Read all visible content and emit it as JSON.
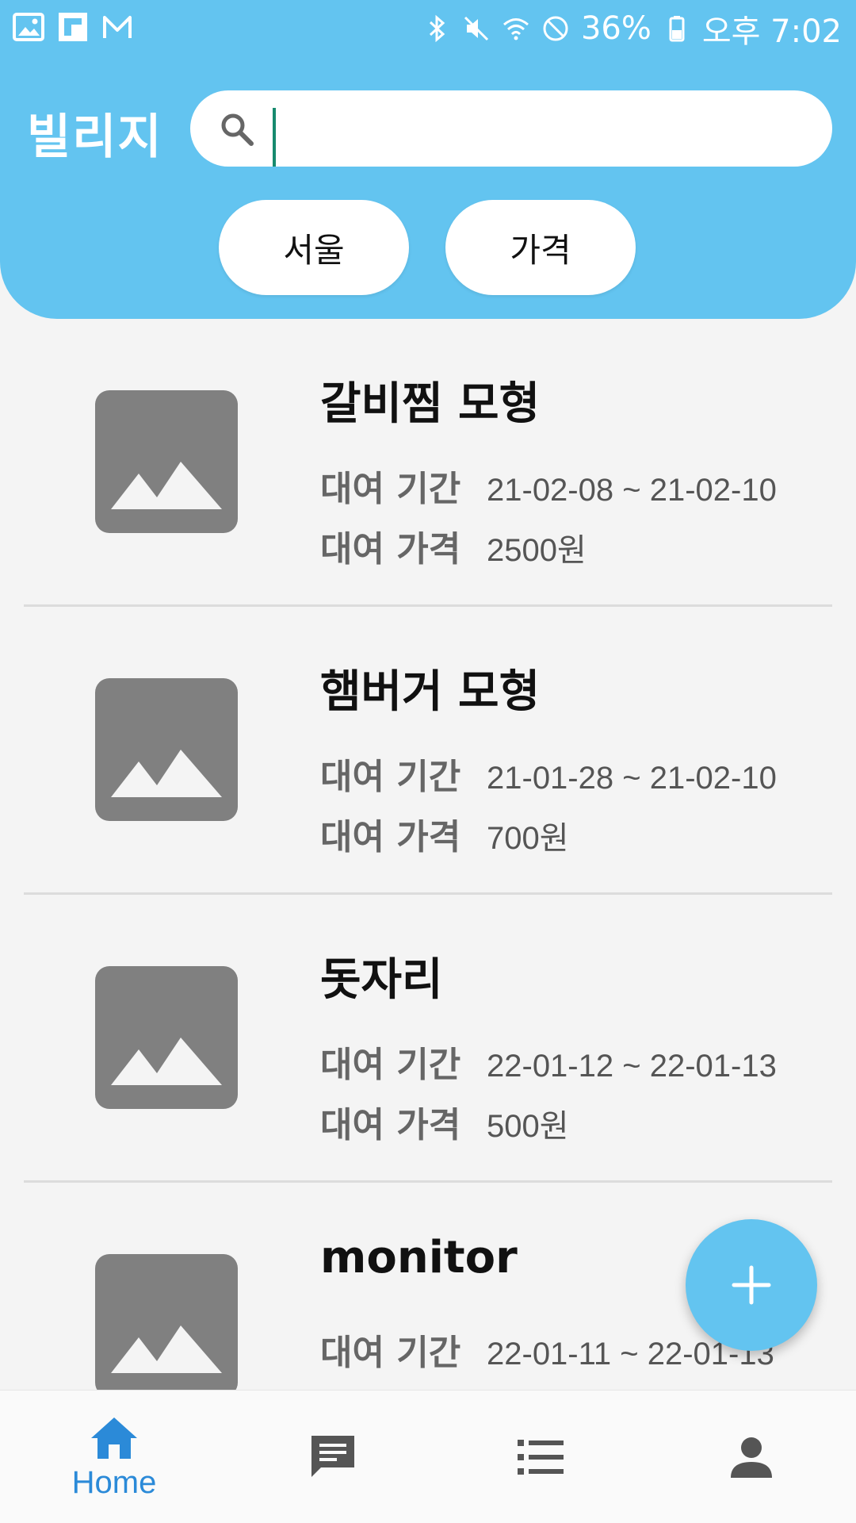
{
  "status_bar": {
    "battery": "36%",
    "time": "오후 7:02"
  },
  "header": {
    "app_title": "빌리지",
    "search": {
      "value": "",
      "placeholder": ""
    },
    "chips": {
      "region": "서울",
      "price": "가격"
    }
  },
  "labels": {
    "period": "대여 기간",
    "price": "대여 가격"
  },
  "items": [
    {
      "title": "갈비찜 모형",
      "period": "21-02-08 ~ 21-02-10",
      "price": "2500원"
    },
    {
      "title": "햄버거 모형",
      "period": "21-01-28 ~ 21-02-10",
      "price": "700원"
    },
    {
      "title": "돗자리",
      "period": "22-01-12 ~ 22-01-13",
      "price": "500원"
    },
    {
      "title": "monitor",
      "period": "22-01-11 ~ 22-01-13",
      "price": ""
    }
  ],
  "bottom_nav": {
    "home_label": "Home"
  },
  "colors": {
    "primary": "#63c4f0",
    "nav_active": "#2b8ad8",
    "placeholder_image": "#808080"
  }
}
